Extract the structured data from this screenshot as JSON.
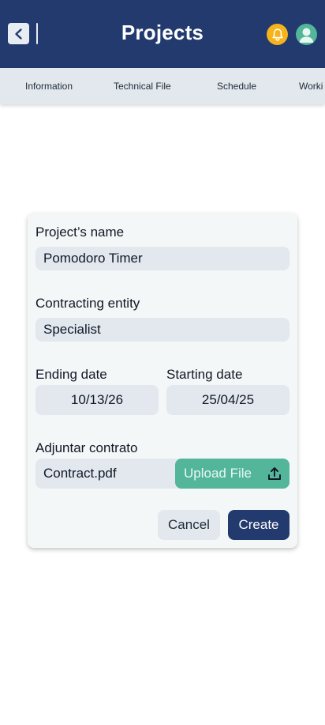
{
  "header": {
    "title": "Projects",
    "back_icon": "chevron-left-icon",
    "notification_icon": "bell-icon",
    "profile_icon": "user-icon",
    "colors": {
      "bar": "#223a6e",
      "bell": "#f6b31b",
      "avatar": "#53b69a"
    }
  },
  "tabs": [
    {
      "label": "Information"
    },
    {
      "label": "Technical File"
    },
    {
      "label": "Schedule"
    },
    {
      "label": "Worki"
    }
  ],
  "form": {
    "project_name": {
      "label": "Project’s name",
      "value": "Pomodoro Timer"
    },
    "contracting_entity": {
      "label": "Contracting entity",
      "value": "Specialist"
    },
    "ending_date": {
      "label": "Ending date",
      "value": "10/13/26"
    },
    "starting_date": {
      "label": "Starting date",
      "value": "25/04/25"
    },
    "contract": {
      "label": "Adjuntar contrato",
      "file_name": "Contract.pdf",
      "upload_label": "Upload File",
      "upload_icon": "upload-icon"
    },
    "cancel_label": "Cancel",
    "create_label": "Create",
    "colors": {
      "upload": "#53b69a",
      "create": "#223a6e"
    }
  }
}
